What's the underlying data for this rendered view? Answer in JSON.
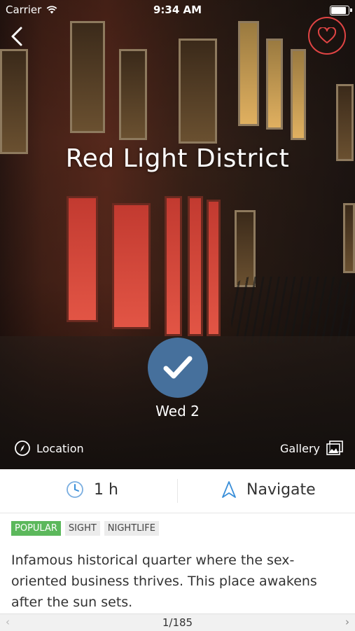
{
  "status_bar": {
    "carrier": "Carrier",
    "time": "9:34 AM",
    "battery_level": 1.0
  },
  "place": {
    "title": "Red Light District"
  },
  "visit": {
    "date_label": "Wed 2"
  },
  "links": {
    "location_label": "Location",
    "gallery_label": "Gallery"
  },
  "info": {
    "duration": "1 h",
    "navigate_label": "Navigate"
  },
  "tags": [
    "POPULAR",
    "SIGHT",
    "NIGHTLIFE"
  ],
  "description": "Infamous historical quarter where the sex-oriented business thrives. This place awakens after the sun sets.",
  "pager": {
    "label": "1/185",
    "prev": "‹",
    "next": "›"
  },
  "colors": {
    "accent_red": "#e04444",
    "check_blue": "#46709c",
    "popular_green": "#5cb85c",
    "navigate_blue": "#3a8fd9"
  },
  "icons": [
    "wifi-icon",
    "back-icon",
    "heart-icon",
    "check-icon",
    "compass-icon",
    "gallery-icon",
    "clock-icon",
    "navigate-arrow-icon"
  ]
}
